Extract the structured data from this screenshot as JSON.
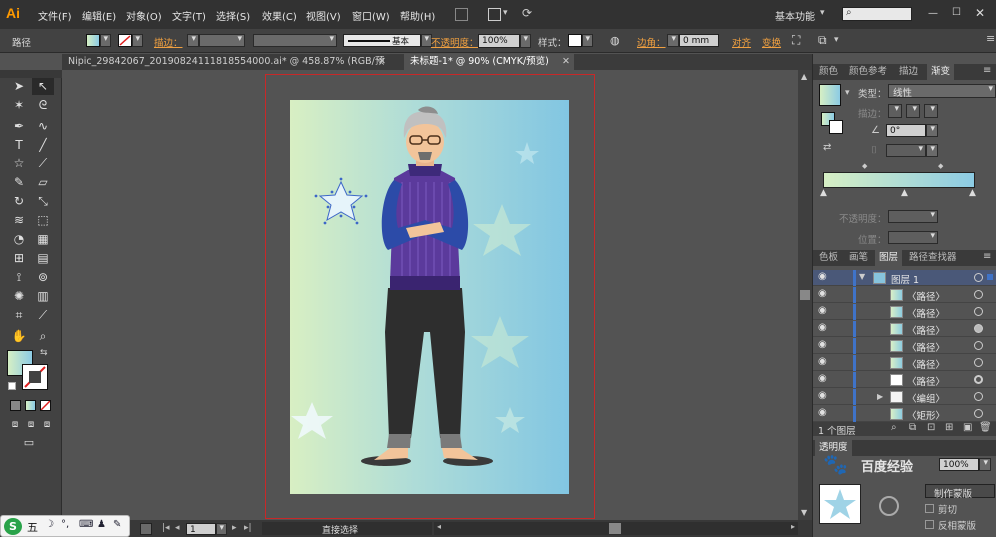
{
  "app": {
    "logo": "Ai"
  },
  "menu": [
    "文件(F)",
    "编辑(E)",
    "对象(O)",
    "文字(T)",
    "选择(S)",
    "效果(C)",
    "视图(V)",
    "窗口(W)",
    "帮助(H)"
  ],
  "workspace": {
    "label": "基本功能",
    "search_icon": "search-icon"
  },
  "control": {
    "object_type": "路径",
    "stroke_label": "描边：",
    "stroke_style": "基本",
    "opacity_label": "不透明度：",
    "opacity_value": "100%",
    "style_label": "样式：",
    "corner_label": "边角：",
    "corner_value": "0 mm",
    "align_label": "对齐",
    "transform_label": "变换"
  },
  "tabs": [
    {
      "label": "Nipic_29842067_20190824111818554000.ai* @ 458.87% (RGB/预览)",
      "active": false
    },
    {
      "label": "未标题-1* @ 90% (CMYK/预览)",
      "active": true
    }
  ],
  "status": {
    "zoom": "90%",
    "page": "1",
    "tool": "直接选择"
  },
  "gradient_panel": {
    "tabs": [
      "颜色",
      "颜色参考",
      "描边",
      "渐变"
    ],
    "type_label": "类型：",
    "type_value": "线性",
    "stroke_label": "描边：",
    "angle_value": "0°",
    "opacity_label": "不透明度：",
    "position_label": "位置：",
    "gradient_start": "#d6efc4",
    "gradient_end": "#8ccbe4"
  },
  "layers_panel": {
    "tabs": [
      "色板",
      "画笔",
      "图层",
      "路径查找器"
    ],
    "rows": [
      {
        "name": "图层 1",
        "level": 0
      },
      {
        "name": "〈路径〉",
        "level": 1
      },
      {
        "name": "〈路径〉",
        "level": 1
      },
      {
        "name": "〈路径〉",
        "level": 1
      },
      {
        "name": "〈路径〉",
        "level": 1
      },
      {
        "name": "〈路径〉",
        "level": 1
      },
      {
        "name": "〈路径〉",
        "level": 1
      },
      {
        "name": "〈编组〉",
        "level": 1
      },
      {
        "name": "〈矩形〉",
        "level": 1
      }
    ],
    "footer": "1 个图层"
  },
  "bottom_panel": {
    "label": "透明度",
    "opacity_value": "100%",
    "make_mask": "制作蒙版",
    "clip": "剪切",
    "invert_mask": "反相蒙版"
  },
  "ime": {
    "label": "五"
  },
  "watermark": "百度经验"
}
